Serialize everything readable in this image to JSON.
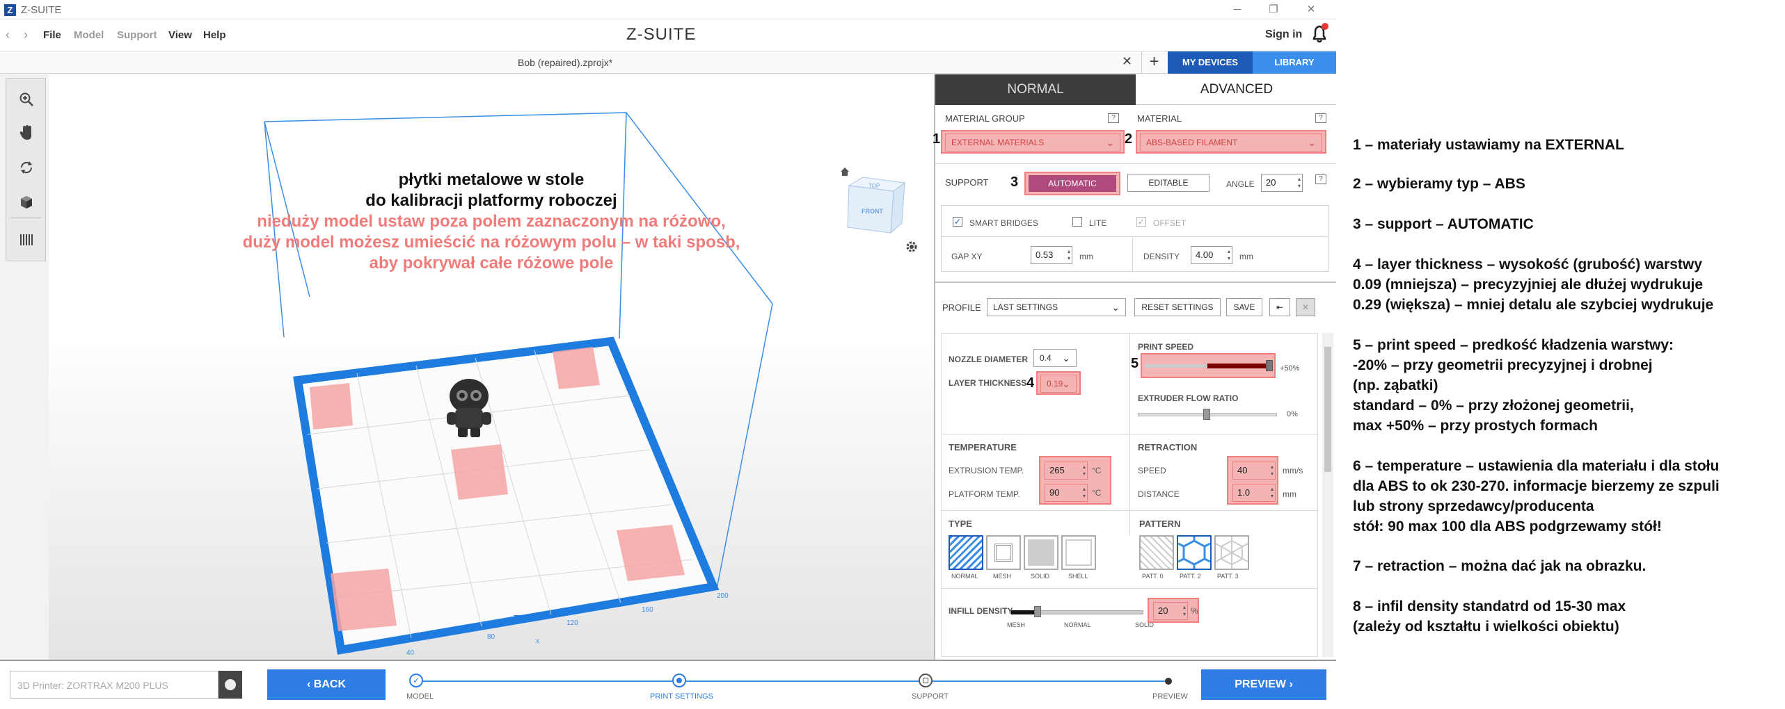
{
  "titlebar": {
    "logo": "Z",
    "title": "Z-SUITE",
    "minimize": "─",
    "restore": "❐",
    "close": "✕"
  },
  "menubar": {
    "back": "‹",
    "forward": "›",
    "items": [
      "File",
      "Model",
      "Support",
      "View",
      "Help"
    ],
    "brand": "Z-SUITE",
    "signin": "Sign in"
  },
  "tabbar": {
    "file": "Bob (repaired).zprojx*",
    "close": "✕",
    "add": "+",
    "my_devices": "MY DEVICES",
    "library": "LIBRARY"
  },
  "toolbar": {
    "tools": [
      "zoom-icon",
      "pan-hand-icon",
      "rotate-icon",
      "cube-view-icon",
      "layers-icon"
    ]
  },
  "viewport": {
    "note_black_1": "płytki metalowe w stole",
    "note_black_2": "do kalibracji platformy roboczej",
    "note_pink_1": "nieduży model ustaw poza polem zaznaczonym na różowo,",
    "note_pink_2": "duży model możesz umieścić na różowym polu – w taki sposb,",
    "note_pink_3": "aby pokrywał całe różowe pole",
    "axis_ticks": [
      "40",
      "80",
      "120",
      "160",
      "200"
    ],
    "axis_x": "x",
    "nav_cube_top": "TOP",
    "nav_cube_front": "FRONT",
    "colors": {
      "bed_border": "#1e7be0",
      "calib_pads": "#f5a3a3",
      "frame": "#3a8ee6"
    }
  },
  "panel": {
    "tab_normal": "NORMAL",
    "tab_advanced": "ADVANCED",
    "material_group_label": "MATERIAL GROUP",
    "material_group_value": "EXTERNAL MATERIALS",
    "material_label": "MATERIAL",
    "material_value": "ABS-BASED FILAMENT",
    "help": "?",
    "support_label": "SUPPORT",
    "support_auto": "AUTOMATIC",
    "support_edit": "EDITABLE",
    "angle_label": "ANGLE",
    "angle_value": "20",
    "smart_bridges": "SMART BRIDGES",
    "lite": "LITE",
    "offset": "OFFSET",
    "gap_xy_label": "GAP XY",
    "gap_xy_value": "0.53",
    "gap_unit": "mm",
    "density_label": "DENSITY",
    "density_value": "4.00",
    "density_unit": "mm",
    "profile_label": "PROFILE",
    "profile_value": "LAST SETTINGS",
    "reset": "RESET SETTINGS",
    "save": "SAVE",
    "nozzle_label": "NOZZLE DIAMETER",
    "nozzle_value": "0.4",
    "layer_label": "LAYER THICKNESS",
    "layer_value": "0.19",
    "print_speed_label": "PRINT SPEED",
    "print_speed_value": "+50%",
    "print_speed_level": 1.0,
    "flow_label": "EXTRUDER FLOW RATIO",
    "flow_value": "0%",
    "temperature_label": "TEMPERATURE",
    "extrusion_label": "EXTRUSION TEMP.",
    "extrusion_value": "265",
    "platform_label": "PLATFORM TEMP.",
    "platform_value": "90",
    "temp_unit": "°C",
    "retraction_label": "RETRACTION",
    "ret_speed_label": "SPEED",
    "ret_speed_value": "40",
    "ret_speed_unit": "mm/s",
    "ret_dist_label": "DISTANCE",
    "ret_dist_value": "1.0",
    "ret_dist_unit": "mm",
    "type_label": "TYPE",
    "types": [
      "NORMAL",
      "MESH",
      "SOLID",
      "SHELL"
    ],
    "pattern_label": "PATTERN",
    "patterns": [
      "PATT. 0",
      "PATT. 2",
      "PATT. 3"
    ],
    "infill_label": "INFILL DENSITY",
    "infill_value": "20",
    "infill_unit": "%",
    "infill_scale": [
      "MESH",
      "NORMAL",
      "SOLID"
    ],
    "marks": [
      "1",
      "2",
      "3",
      "4",
      "5"
    ]
  },
  "bottombar": {
    "printer": "3D Printer: ZORTRAX M200 PLUS",
    "back": "‹ BACK",
    "steps": [
      "MODEL",
      "PRINT SETTINGS",
      "SUPPORT",
      "PREVIEW"
    ],
    "preview": "PREVIEW ›"
  },
  "notes": [
    "1 – materiały ustawiamy na EXTERNAL",
    "2 – wybieramy typ – ABS",
    "3 – support – AUTOMATIC",
    "4 – layer thickness – wysokość (grubość) warstwy",
    "0.09 (mniejsza) – precyzyjniej ale dłużej wydrukuje",
    "0.29 (większa) – mniej detalu ale szybciej wydrukuje",
    "5 – print speed – predkość kładzenia warstwy:",
    "-20% – przy geometrii precyzyjnej i drobnej",
    "(np. ząbatki)",
    "standard – 0% – przy złożonej geometrii,",
    "max +50% – przy prostych formach",
    "6 – temperature – ustawienia dla materiału i dla stołu",
    "dla ABS to ok 230-270. informacje bierzemy ze szpuli",
    "lub strony sprzedawcy/producenta",
    "stół: 90 max 100 dla ABS podgrzewamy stół!",
    "7 – retraction – można dać jak na obrazku.",
    "8 – infil density standatrd od 15-30 max",
    "(zależy od kształtu i wielkości obiektu)"
  ]
}
